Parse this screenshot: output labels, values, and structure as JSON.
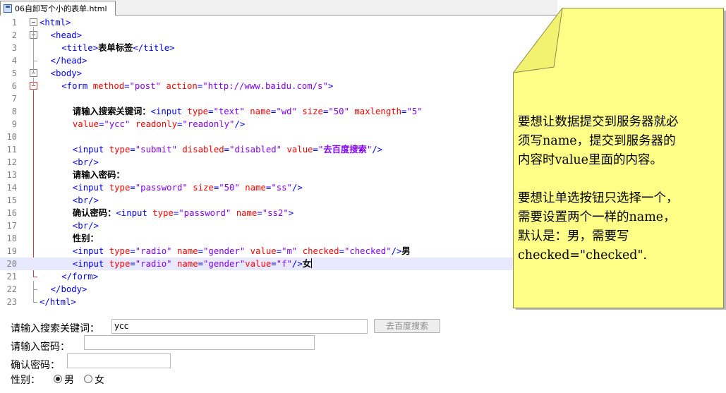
{
  "editor": {
    "tab_title": "06自卸写个小的表单.html",
    "current_line": 20,
    "lines": [
      {
        "n": "1",
        "tokens": [
          [
            "t",
            "<html>"
          ]
        ]
      },
      {
        "n": "2",
        "tokens": [
          [
            "x",
            "    "
          ],
          [
            "t",
            "<head>"
          ]
        ]
      },
      {
        "n": "3",
        "tokens": [
          [
            "x",
            "        "
          ],
          [
            "t",
            "<title>"
          ],
          [
            "xb",
            "表单标签"
          ],
          [
            "t",
            "</title>"
          ]
        ]
      },
      {
        "n": "4",
        "tokens": [
          [
            "x",
            "    "
          ],
          [
            "t",
            "</head>"
          ]
        ]
      },
      {
        "n": "5",
        "tokens": [
          [
            "x",
            "    "
          ],
          [
            "t",
            "<body>"
          ]
        ]
      },
      {
        "n": "6",
        "tokens": [
          [
            "x",
            "        "
          ],
          [
            "t",
            "<form "
          ],
          [
            "a",
            "method"
          ],
          [
            "t",
            "="
          ],
          [
            "v",
            "\"post\""
          ],
          [
            "t",
            " "
          ],
          [
            "a",
            "action"
          ],
          [
            "t",
            "="
          ],
          [
            "v",
            "\"http://www.baidu.com/s\""
          ],
          [
            "t",
            ">"
          ]
        ]
      },
      {
        "n": "7",
        "tokens": []
      },
      {
        "n": "8",
        "tokens": [
          [
            "x",
            "            "
          ],
          [
            "xb",
            "请输入搜索关键词："
          ],
          [
            "t",
            "<input "
          ],
          [
            "a",
            "type"
          ],
          [
            "t",
            "="
          ],
          [
            "v",
            "\"text\""
          ],
          [
            "t",
            " "
          ],
          [
            "a",
            "name"
          ],
          [
            "t",
            "="
          ],
          [
            "v",
            "\"wd\""
          ],
          [
            "t",
            " "
          ],
          [
            "a",
            "size"
          ],
          [
            "t",
            "="
          ],
          [
            "v",
            "\"50\""
          ],
          [
            "t",
            " "
          ],
          [
            "a",
            "maxlength"
          ],
          [
            "t",
            "="
          ],
          [
            "v",
            "\"5\""
          ]
        ]
      },
      {
        "n": "9",
        "tokens": [
          [
            "x",
            "            "
          ],
          [
            "a",
            "value"
          ],
          [
            "t",
            "="
          ],
          [
            "v",
            "\"ycc\""
          ],
          [
            "t",
            " "
          ],
          [
            "a",
            "readonly"
          ],
          [
            "t",
            "="
          ],
          [
            "v",
            "\"readonly\""
          ],
          [
            "t",
            "/>"
          ]
        ]
      },
      {
        "n": "10",
        "tokens": []
      },
      {
        "n": "11",
        "tokens": [
          [
            "x",
            "            "
          ],
          [
            "t",
            "<input "
          ],
          [
            "a",
            "type"
          ],
          [
            "t",
            "="
          ],
          [
            "v",
            "\"submit\""
          ],
          [
            "t",
            " "
          ],
          [
            "a",
            "disabled"
          ],
          [
            "t",
            "="
          ],
          [
            "v",
            "\"disabled\""
          ],
          [
            "t",
            " "
          ],
          [
            "a",
            "value"
          ],
          [
            "t",
            "="
          ],
          [
            "v",
            "\""
          ],
          [
            "vb",
            "去百度搜索"
          ],
          [
            "v",
            "\""
          ],
          [
            "t",
            "/>"
          ]
        ]
      },
      {
        "n": "12",
        "tokens": [
          [
            "x",
            "            "
          ],
          [
            "t",
            "<br/>"
          ]
        ]
      },
      {
        "n": "13",
        "tokens": [
          [
            "x",
            "            "
          ],
          [
            "xb",
            "请输入密码："
          ]
        ]
      },
      {
        "n": "14",
        "tokens": [
          [
            "x",
            "            "
          ],
          [
            "t",
            "<input "
          ],
          [
            "a",
            "type"
          ],
          [
            "t",
            "="
          ],
          [
            "v",
            "\"password\""
          ],
          [
            "t",
            " "
          ],
          [
            "a",
            "size"
          ],
          [
            "t",
            "="
          ],
          [
            "v",
            "\"50\""
          ],
          [
            "t",
            " "
          ],
          [
            "a",
            "name"
          ],
          [
            "t",
            "="
          ],
          [
            "v",
            "\"ss\""
          ],
          [
            "t",
            "/>"
          ]
        ]
      },
      {
        "n": "15",
        "tokens": [
          [
            "x",
            "            "
          ],
          [
            "t",
            "<br/>"
          ]
        ]
      },
      {
        "n": "16",
        "tokens": [
          [
            "x",
            "            "
          ],
          [
            "xb",
            "确认密码："
          ],
          [
            "t",
            "<input "
          ],
          [
            "a",
            "type"
          ],
          [
            "t",
            "="
          ],
          [
            "v",
            "\"password\""
          ],
          [
            "t",
            " "
          ],
          [
            "a",
            "name"
          ],
          [
            "t",
            "="
          ],
          [
            "v",
            "\"ss2\""
          ],
          [
            "t",
            ">"
          ]
        ]
      },
      {
        "n": "17",
        "tokens": [
          [
            "x",
            "            "
          ],
          [
            "t",
            "<br/>"
          ]
        ]
      },
      {
        "n": "18",
        "tokens": [
          [
            "x",
            "            "
          ],
          [
            "xb",
            "性别："
          ]
        ]
      },
      {
        "n": "19",
        "tokens": [
          [
            "x",
            "            "
          ],
          [
            "t",
            "<input "
          ],
          [
            "a",
            "type"
          ],
          [
            "t",
            "="
          ],
          [
            "v",
            "\"radio\""
          ],
          [
            "t",
            " "
          ],
          [
            "a",
            "name"
          ],
          [
            "t",
            "="
          ],
          [
            "v",
            "\"gender\""
          ],
          [
            "t",
            " "
          ],
          [
            "a",
            "value"
          ],
          [
            "t",
            "="
          ],
          [
            "v",
            "\"m\""
          ],
          [
            "t",
            " "
          ],
          [
            "a",
            "checked"
          ],
          [
            "t",
            "="
          ],
          [
            "v",
            "\"checked\""
          ],
          [
            "t",
            "/>"
          ],
          [
            "xb",
            "男"
          ]
        ]
      },
      {
        "n": "20",
        "tokens": [
          [
            "x",
            "            "
          ],
          [
            "t",
            "<input "
          ],
          [
            "a",
            "type"
          ],
          [
            "t",
            "="
          ],
          [
            "v",
            "\"radio\""
          ],
          [
            "t",
            " "
          ],
          [
            "a",
            "name"
          ],
          [
            "t",
            "="
          ],
          [
            "v",
            "\"gender\""
          ],
          [
            "a",
            "value"
          ],
          [
            "t",
            "="
          ],
          [
            "v",
            "\"f\""
          ],
          [
            "t",
            "/>"
          ],
          [
            "xb",
            "女"
          ]
        ]
      },
      {
        "n": "21",
        "tokens": [
          [
            "x",
            "        "
          ],
          [
            "t",
            "</form>"
          ]
        ]
      },
      {
        "n": "22",
        "tokens": [
          [
            "x",
            "    "
          ],
          [
            "t",
            "</body>"
          ]
        ]
      },
      {
        "n": "23",
        "tokens": [
          [
            "t",
            "</html>"
          ]
        ]
      }
    ]
  },
  "note": {
    "paragraph1": [
      "要想让数据提交到服务器就必",
      "须写name，提交到服务器的",
      "内容时value里面的内容。"
    ],
    "paragraph2": [
      "要想让单选按钮只选择一个，",
      "需要设置两个一样的name，",
      "默认是：男，需要写",
      "checked=\"checked\"."
    ]
  },
  "form": {
    "keyword_label": "请输入搜索关键词：",
    "keyword_value": "ycc",
    "search_button_label": "去百度搜索",
    "password_label": "请输入密码：",
    "confirm_label": "确认密码：",
    "gender_label": "性别：",
    "gender_male": "男",
    "gender_female": "女",
    "gender_checked": "male"
  }
}
